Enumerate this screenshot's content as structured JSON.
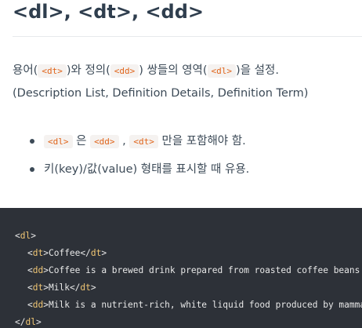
{
  "heading": "<dl>, <dt>, <dd>",
  "paragraph": {
    "part1": "용어(",
    "code1": "<dt>",
    "part2": ")와 정의(",
    "code2": "<dd>",
    "part3": ") 쌍들의 영역(",
    "code3": "<dl>",
    "part4": ")을 설정.",
    "line2": "(Description List, Definition Details, Definition Term)"
  },
  "bullets": [
    {
      "code1": "<dl>",
      "text1": " 은 ",
      "code2": "<dd>",
      "text2": " , ",
      "code3": "<dt>",
      "text3": " 만을 포함해야 함."
    },
    {
      "text": "키(key)/값(value) 형태를 표시할 때 유용."
    }
  ],
  "code_lines": [
    {
      "open": "<",
      "tag": "dl",
      "close": ">",
      "content": "",
      "end_open": "",
      "end_tag": "",
      "end_close": ""
    },
    {
      "open": "<",
      "tag": "dt",
      "close": ">",
      "content": "Coffee",
      "end_open": "</",
      "end_tag": "dt",
      "end_close": ">"
    },
    {
      "open": "<",
      "tag": "dd",
      "close": ">",
      "content": "Coffee is a brewed drink prepared from roasted coffee beans.",
      "end_open": "",
      "end_tag": "",
      "end_close": ""
    },
    {
      "open": "<",
      "tag": "dt",
      "close": ">",
      "content": "Milk",
      "end_open": "</",
      "end_tag": "dt",
      "end_close": ">"
    },
    {
      "open": "<",
      "tag": "dd",
      "close": ">",
      "content": "Milk is a nutrient-rich, white liquid food produced by mammals.",
      "end_open": "",
      "end_tag": "",
      "end_close": ""
    },
    {
      "open": "</",
      "tag": "dl",
      "close": ">",
      "content": "",
      "end_open": "",
      "end_tag": "",
      "end_close": ""
    }
  ]
}
